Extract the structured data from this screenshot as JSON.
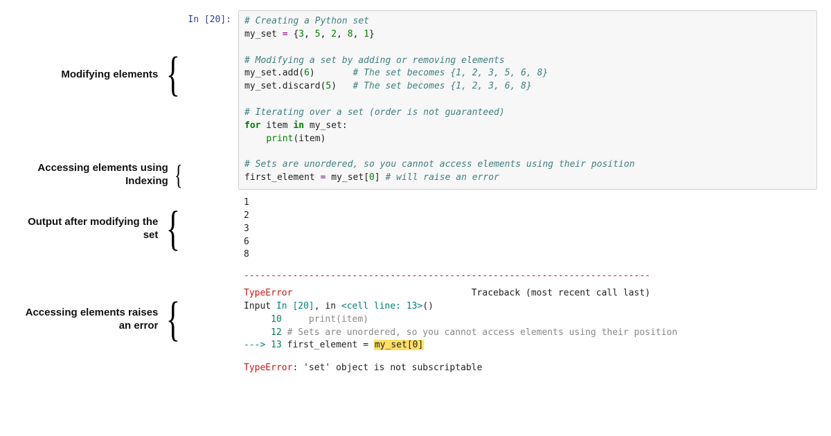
{
  "prompt": "In [20]:",
  "labels": {
    "modify": "Modifying elements",
    "index": "Accessing elements using Indexing",
    "output": "Output after modifying the set",
    "error": "Accessing elements raises an error"
  },
  "code": {
    "l1_comment": "# Creating a Python set",
    "l2_a": "my_set ",
    "l2_b": "=",
    "l2_c": " {",
    "l2_d": "3",
    "l2_e": ", ",
    "l2_f": "5",
    "l2_g": ", ",
    "l2_h": "2",
    "l2_i": ", ",
    "l2_j": "8",
    "l2_k": ", ",
    "l2_l": "1",
    "l2_m": "}",
    "blank": "",
    "l4_comment": "# Modifying a set by adding or removing elements",
    "l5_a": "my_set.add(",
    "l5_b": "6",
    "l5_c": ")       ",
    "l5_d": "# The set becomes {1, 2, 3, 5, 6, 8}",
    "l6_a": "my_set.discard(",
    "l6_b": "5",
    "l6_c": ")   ",
    "l6_d": "# The set becomes {1, 2, 3, 6, 8}",
    "l8_comment": "# Iterating over a set (order is not guaranteed)",
    "l9_a": "for",
    "l9_b": " item ",
    "l9_c": "in",
    "l9_d": " my_set:",
    "l10_a": "    ",
    "l10_b": "print",
    "l10_c": "(item)",
    "l12_comment": "# Sets are unordered, so you cannot access elements using their position",
    "l13_a": "first_element ",
    "l13_b": "=",
    "l13_c": " my_set[",
    "l13_d": "0",
    "l13_e": "] ",
    "l13_f": "# will raise an error"
  },
  "output": {
    "n1": "1",
    "n2": "2",
    "n3": "3",
    "n4": "6",
    "n5": "8"
  },
  "traceback": {
    "dashes": "---------------------------------------------------------------------------",
    "head_err": "TypeError",
    "head_trace_pad": "                                 ",
    "head_trace": "Traceback (most recent call last)",
    "line_input_a": "Input ",
    "line_input_b": "In [20]",
    "line_input_c": ", in ",
    "line_input_d": "<cell line: 13>",
    "line_input_e": "()",
    "l10_pad": "     ",
    "l10_num": "10",
    "l10_body": "     print(item)",
    "l12_pad": "     ",
    "l12_num": "12",
    "l12_body": " # Sets are unordered, so you cannot access elements using their position",
    "l13_arrow": "---> ",
    "l13_num": "13",
    "l13_body_a": " first_element = ",
    "l13_body_b": "my_set[",
    "l13_body_c": "0",
    "l13_body_d": "]",
    "final_err": "TypeError",
    "final_colon": ": ",
    "final_msg": "'set' object is not subscriptable"
  }
}
